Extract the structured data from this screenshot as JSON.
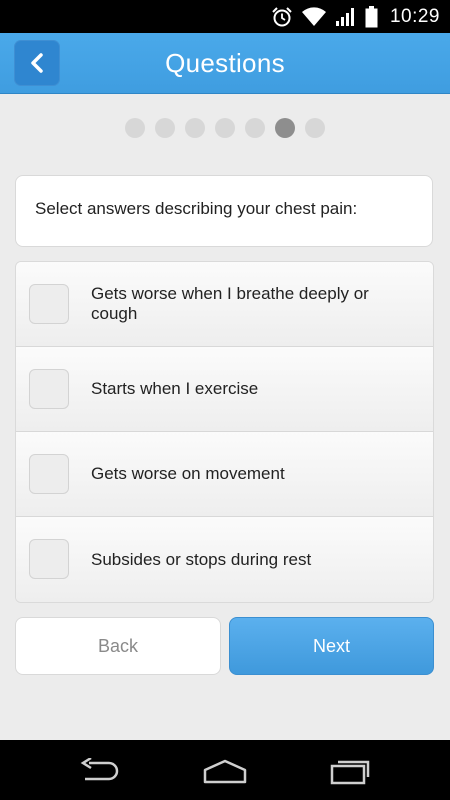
{
  "status_bar": {
    "time": "10:29",
    "icons": [
      "alarm-icon",
      "wifi-icon",
      "signal-icon",
      "battery-icon"
    ]
  },
  "header": {
    "title": "Questions",
    "back_icon": "chevron-left-icon"
  },
  "progress": {
    "total_steps": 7,
    "current_step": 6
  },
  "question": {
    "text": "Select answers describing your chest pain:"
  },
  "options": [
    {
      "label": "Gets worse when I breathe deeply or cough",
      "checked": false
    },
    {
      "label": "Starts when I exercise",
      "checked": false
    },
    {
      "label": "Gets worse on movement",
      "checked": false
    },
    {
      "label": "Subsides or stops during rest",
      "checked": false
    }
  ],
  "buttons": {
    "back_label": "Back",
    "next_label": "Next"
  },
  "nav_bar": {
    "icons": [
      "back-nav-icon",
      "home-nav-icon",
      "recents-nav-icon"
    ]
  },
  "colors": {
    "header_blue": "#4aa9ea",
    "next_blue": "#4aa3e6",
    "active_dot": "#8e8e8e",
    "inactive_dot": "#d7d7d7"
  }
}
